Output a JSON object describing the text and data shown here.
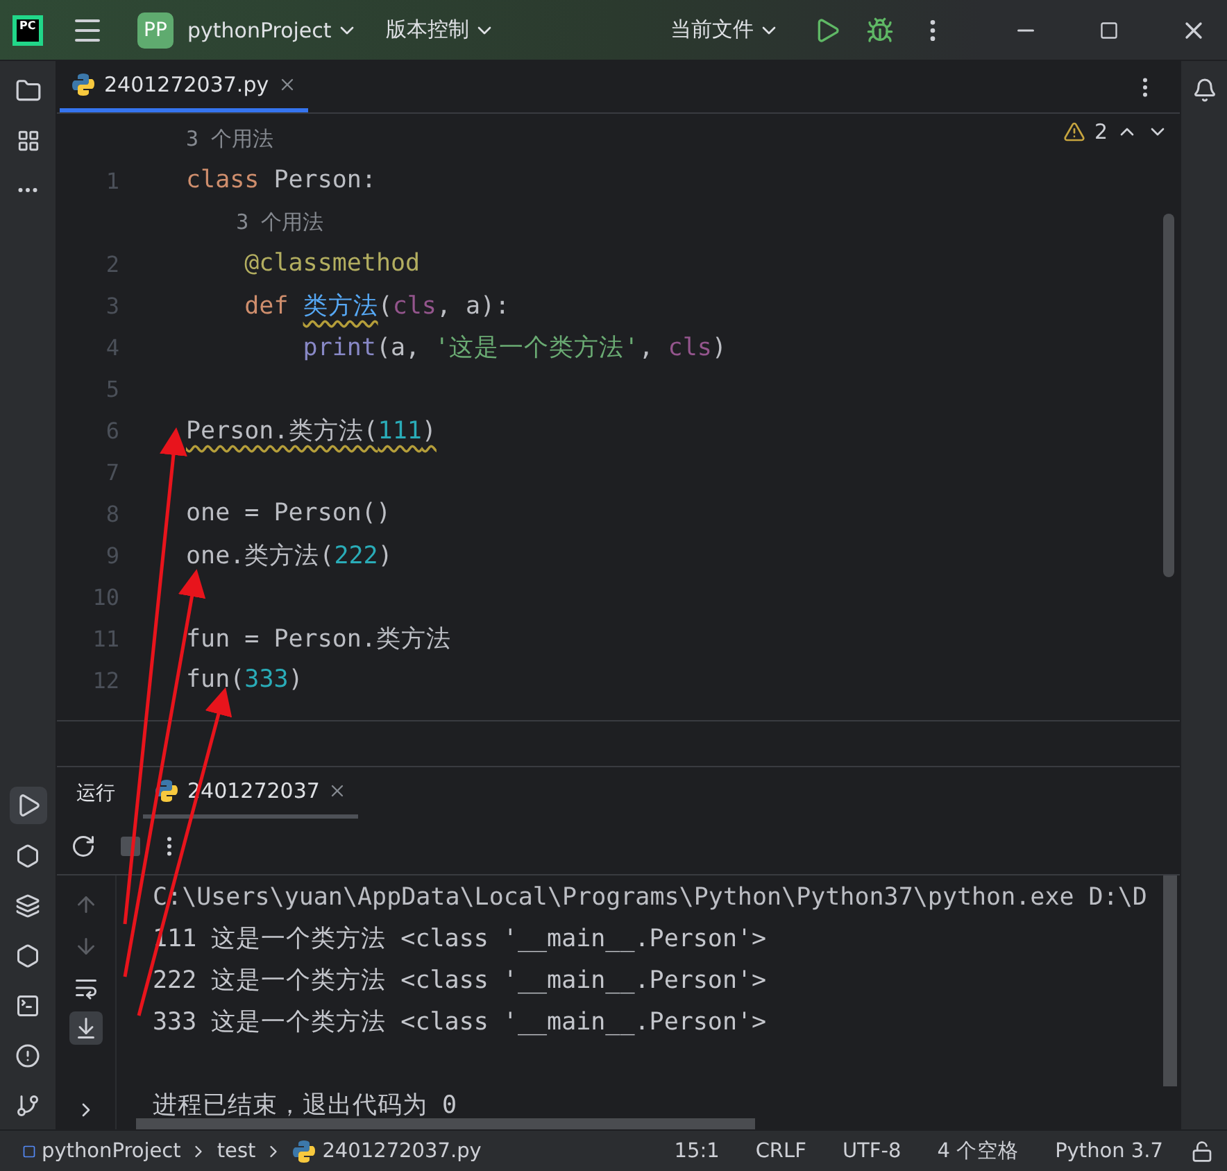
{
  "title_bar": {
    "app_badge": "PC",
    "project_badge": "PP",
    "project": "pythonProject",
    "vcs": "版本控制",
    "run_config": "当前文件"
  },
  "editor_tabs": [
    {
      "label": "2401272037.py",
      "selected": true
    }
  ],
  "inspection": {
    "count": "2"
  },
  "code": [
    {
      "kind": "hint",
      "text": "3 个用法"
    },
    {
      "kind": "code",
      "number": "1",
      "tokens": [
        {
          "text": "class",
          "kind": "keyword"
        },
        {
          "text": " Person:",
          "kind": "plain"
        }
      ]
    },
    {
      "kind": "hint",
      "text": "    3 个用法"
    },
    {
      "kind": "code",
      "number": "2",
      "tokens": [
        {
          "text": "    @classmethod",
          "kind": "decorator"
        }
      ]
    },
    {
      "kind": "code",
      "number": "3",
      "tokens": [
        {
          "text": "    def ",
          "kind": "keyword"
        },
        {
          "text": "类方法",
          "kind": "function",
          "warned": true
        },
        {
          "text": "(",
          "kind": "plain"
        },
        {
          "text": "cls",
          "kind": "self"
        },
        {
          "text": ", a):",
          "kind": "plain"
        }
      ]
    },
    {
      "kind": "code",
      "number": "4",
      "tokens": [
        {
          "text": "        print",
          "kind": "builtin"
        },
        {
          "text": "(a, ",
          "kind": "plain"
        },
        {
          "text": "'这是一个类方法'",
          "kind": "string"
        },
        {
          "text": ", ",
          "kind": "plain"
        },
        {
          "text": "cls",
          "kind": "self"
        },
        {
          "text": ")",
          "kind": "plain"
        }
      ]
    },
    {
      "kind": "code",
      "number": "5"
    },
    {
      "kind": "code",
      "number": "6",
      "tokens": [
        {
          "text": "Person.类方法(",
          "kind": "plain",
          "warned": true
        },
        {
          "text": "111",
          "kind": "number",
          "warned": true
        },
        {
          "text": ")",
          "kind": "plain",
          "warned": true
        }
      ]
    },
    {
      "kind": "code",
      "number": "7"
    },
    {
      "kind": "code",
      "number": "8",
      "tokens": [
        {
          "text": "one = Person()",
          "kind": "plain"
        }
      ]
    },
    {
      "kind": "code",
      "number": "9",
      "tokens": [
        {
          "text": "one.类方法(",
          "kind": "plain"
        },
        {
          "text": "222",
          "kind": "number"
        },
        {
          "text": ")",
          "kind": "plain"
        }
      ]
    },
    {
      "kind": "code",
      "number": "10"
    },
    {
      "kind": "code",
      "number": "11",
      "tokens": [
        {
          "text": "fun = Person.类方法",
          "kind": "plain"
        }
      ]
    },
    {
      "kind": "code",
      "number": "12",
      "tokens": [
        {
          "text": "fun(",
          "kind": "plain"
        },
        {
          "text": "333",
          "kind": "number"
        },
        {
          "text": ")",
          "kind": "plain"
        }
      ]
    }
  ],
  "run_panel": {
    "title": "运行",
    "tabs": [
      {
        "label": "2401272037",
        "selected": true
      }
    ],
    "console": [
      {
        "kind": "command",
        "text": "C:\\Users\\yuan\\AppData\\Local\\Programs\\Python\\Python37\\python.exe D:\\D"
      },
      {
        "kind": "output",
        "text": "111 这是一个类方法 <class '__main__.Person'>"
      },
      {
        "kind": "output",
        "text": "222 这是一个类方法 <class '__main__.Person'>"
      },
      {
        "kind": "output",
        "text": "333 这是一个类方法 <class '__main__.Person'>"
      },
      {
        "kind": "blank"
      },
      {
        "kind": "output",
        "text": "进程已结束，退出代码为 0"
      }
    ]
  },
  "status_bar": {
    "breadcrumbs": [
      "pythonProject",
      "test",
      "2401272037.py"
    ],
    "items": [
      "15:1",
      "CRLF",
      "UTF-8",
      "4 个空格",
      "Python 3.7"
    ]
  }
}
